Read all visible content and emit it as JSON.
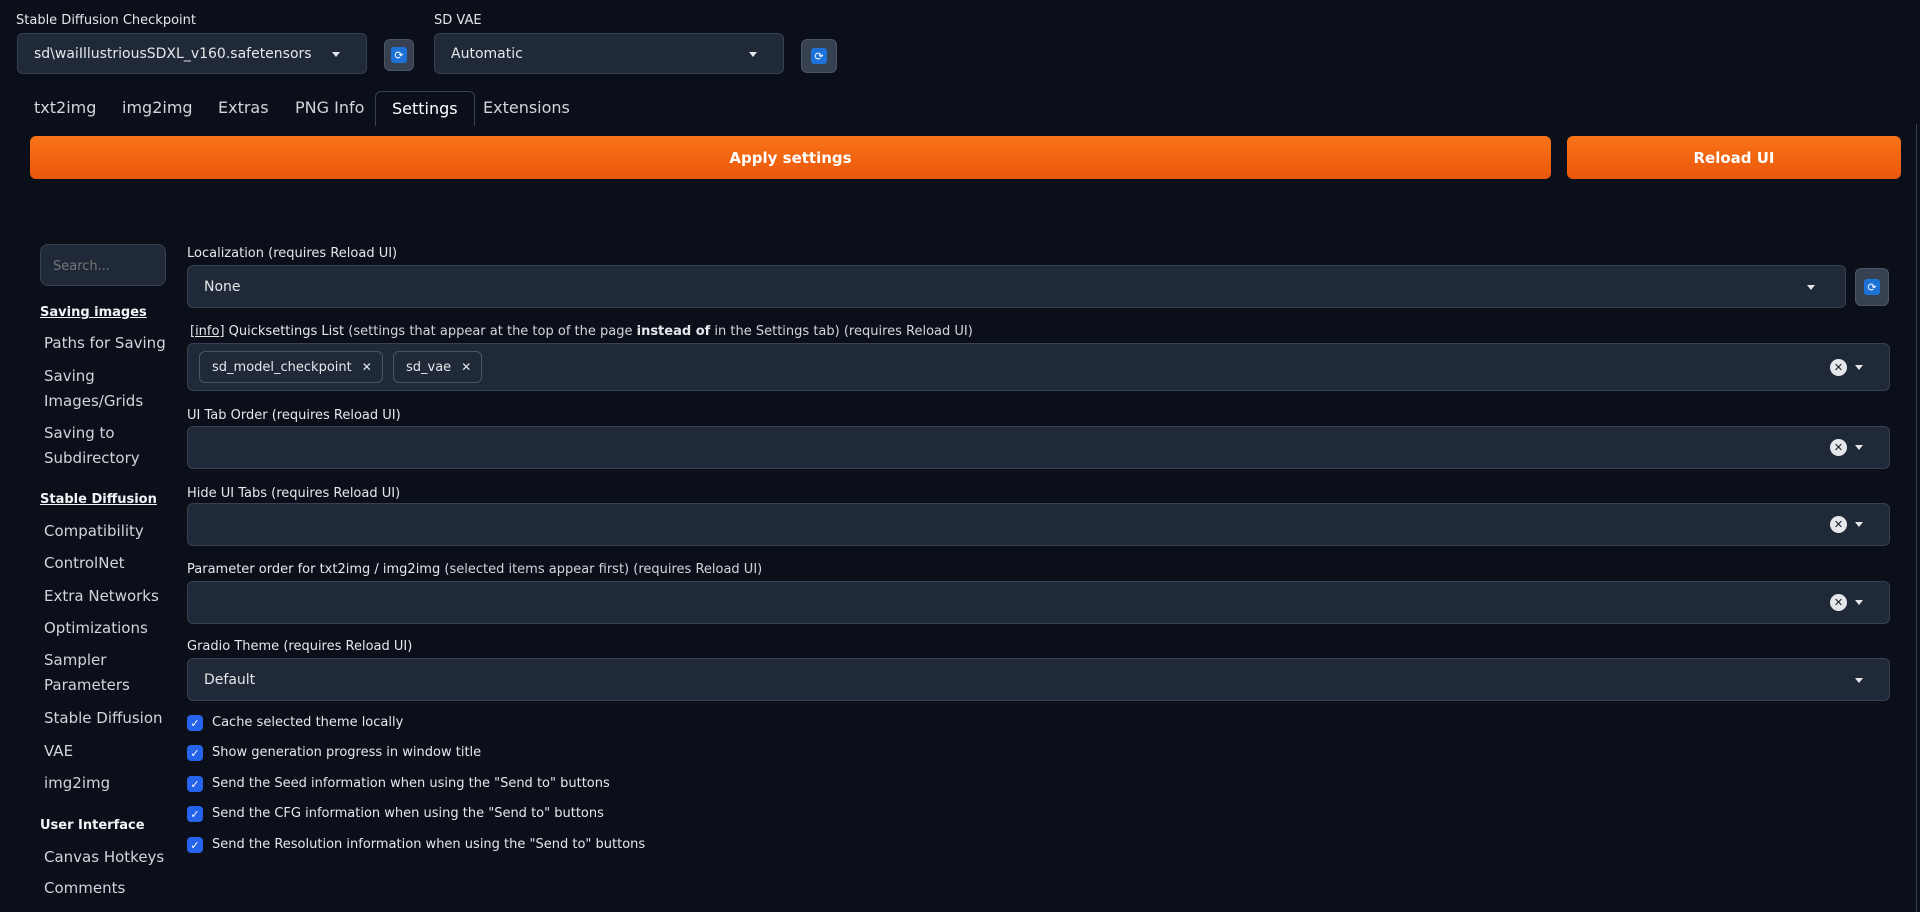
{
  "quicksettings": {
    "checkpoint_label": "Stable Diffusion Checkpoint",
    "checkpoint_value": "sd\\waiIllustriousSDXL_v160.safetensors",
    "vae_label": "SD VAE",
    "vae_value": "Automatic"
  },
  "tabs": [
    "txt2img",
    "img2img",
    "Extras",
    "PNG Info",
    "Settings",
    "Extensions"
  ],
  "active_tab": "Settings",
  "buttons": {
    "apply": "Apply settings",
    "reload": "Reload UI"
  },
  "sidebar": {
    "search_placeholder": "Search...",
    "sections": [
      {
        "header": "Saving images",
        "items": [
          "Paths for Saving",
          "Saving Images/Grids",
          "Saving to Subdirectory"
        ]
      },
      {
        "header": "Stable Diffusion",
        "items": [
          "Compatibility",
          "ControlNet",
          "Extra Networks",
          "Optimizations",
          "Sampler Parameters",
          "Stable Diffusion",
          "VAE",
          "img2img"
        ]
      },
      {
        "header": "User Interface",
        "items": [
          "Canvas Hotkeys",
          "Comments"
        ]
      }
    ]
  },
  "settings": {
    "localization": {
      "label": "Localization",
      "note": "(requires Reload UI)",
      "value": "None"
    },
    "quicksettings": {
      "info": "[info]",
      "label": "Quicksettings List",
      "note_a": "(settings that appear at the top of the page ",
      "note_b": "instead of",
      "note_c": " in the Settings tab) (requires Reload UI)",
      "chips": [
        "sd_model_checkpoint",
        "sd_vae"
      ]
    },
    "tab_order": {
      "label": "UI Tab Order",
      "note": "(requires Reload UI)"
    },
    "hide_tabs": {
      "label": "Hide UI Tabs",
      "note": "(requires Reload UI)"
    },
    "param_order": {
      "label": "Parameter order for txt2img / img2img",
      "note": "(selected items appear first) (requires Reload UI)"
    },
    "theme": {
      "label": "Gradio Theme",
      "note": "(requires Reload UI)",
      "value": "Default"
    },
    "checkboxes": [
      "Cache selected theme locally",
      "Show generation progress in window title",
      "Send the Seed information when using the \"Send to\" buttons",
      "Send the CFG information when using the \"Send to\" buttons",
      "Send the Resolution information when using the \"Send to\" buttons"
    ]
  },
  "colors": {
    "accent": "#f97316",
    "checkbox": "#2563eb",
    "background": "#0b0f19",
    "field": "#1f2937"
  }
}
